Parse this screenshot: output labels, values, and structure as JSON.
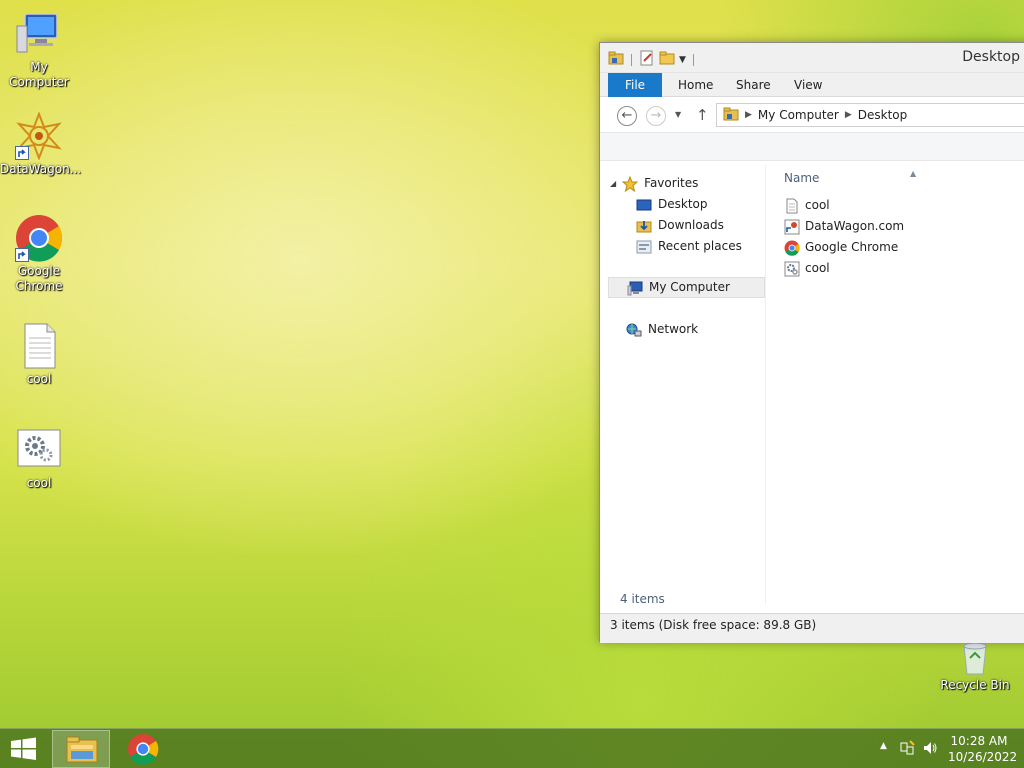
{
  "desktop": {
    "icons": [
      {
        "label": "My Computer"
      },
      {
        "label": "DataWagon..."
      },
      {
        "label": "Google Chrome"
      },
      {
        "label": "cool"
      },
      {
        "label": "cool"
      }
    ],
    "recycle_bin": "Recycle Bin"
  },
  "explorer": {
    "title": "Desktop",
    "tabs": {
      "file": "File",
      "home": "Home",
      "share": "Share",
      "view": "View"
    },
    "breadcrumb": [
      "My Computer",
      "Desktop"
    ],
    "nav": {
      "favorites": "Favorites",
      "desktop": "Desktop",
      "downloads": "Downloads",
      "recent": "Recent places",
      "my_computer": "My Computer",
      "network": "Network"
    },
    "column_name": "Name",
    "files": [
      {
        "name": "cool",
        "icon": "text-file-icon"
      },
      {
        "name": "DataWagon.com",
        "icon": "shortcut-icon"
      },
      {
        "name": "Google Chrome",
        "icon": "chrome-icon"
      },
      {
        "name": "cool",
        "icon": "settings-file-icon"
      }
    ],
    "items_count": "4 items",
    "status": "3 items (Disk free space: 89.8 GB)"
  },
  "taskbar": {
    "time": "10:28 AM",
    "date": "10/26/2022"
  },
  "colors": {
    "ribbon_file_tab": "#1979ca",
    "taskbar": "#466e1e"
  }
}
